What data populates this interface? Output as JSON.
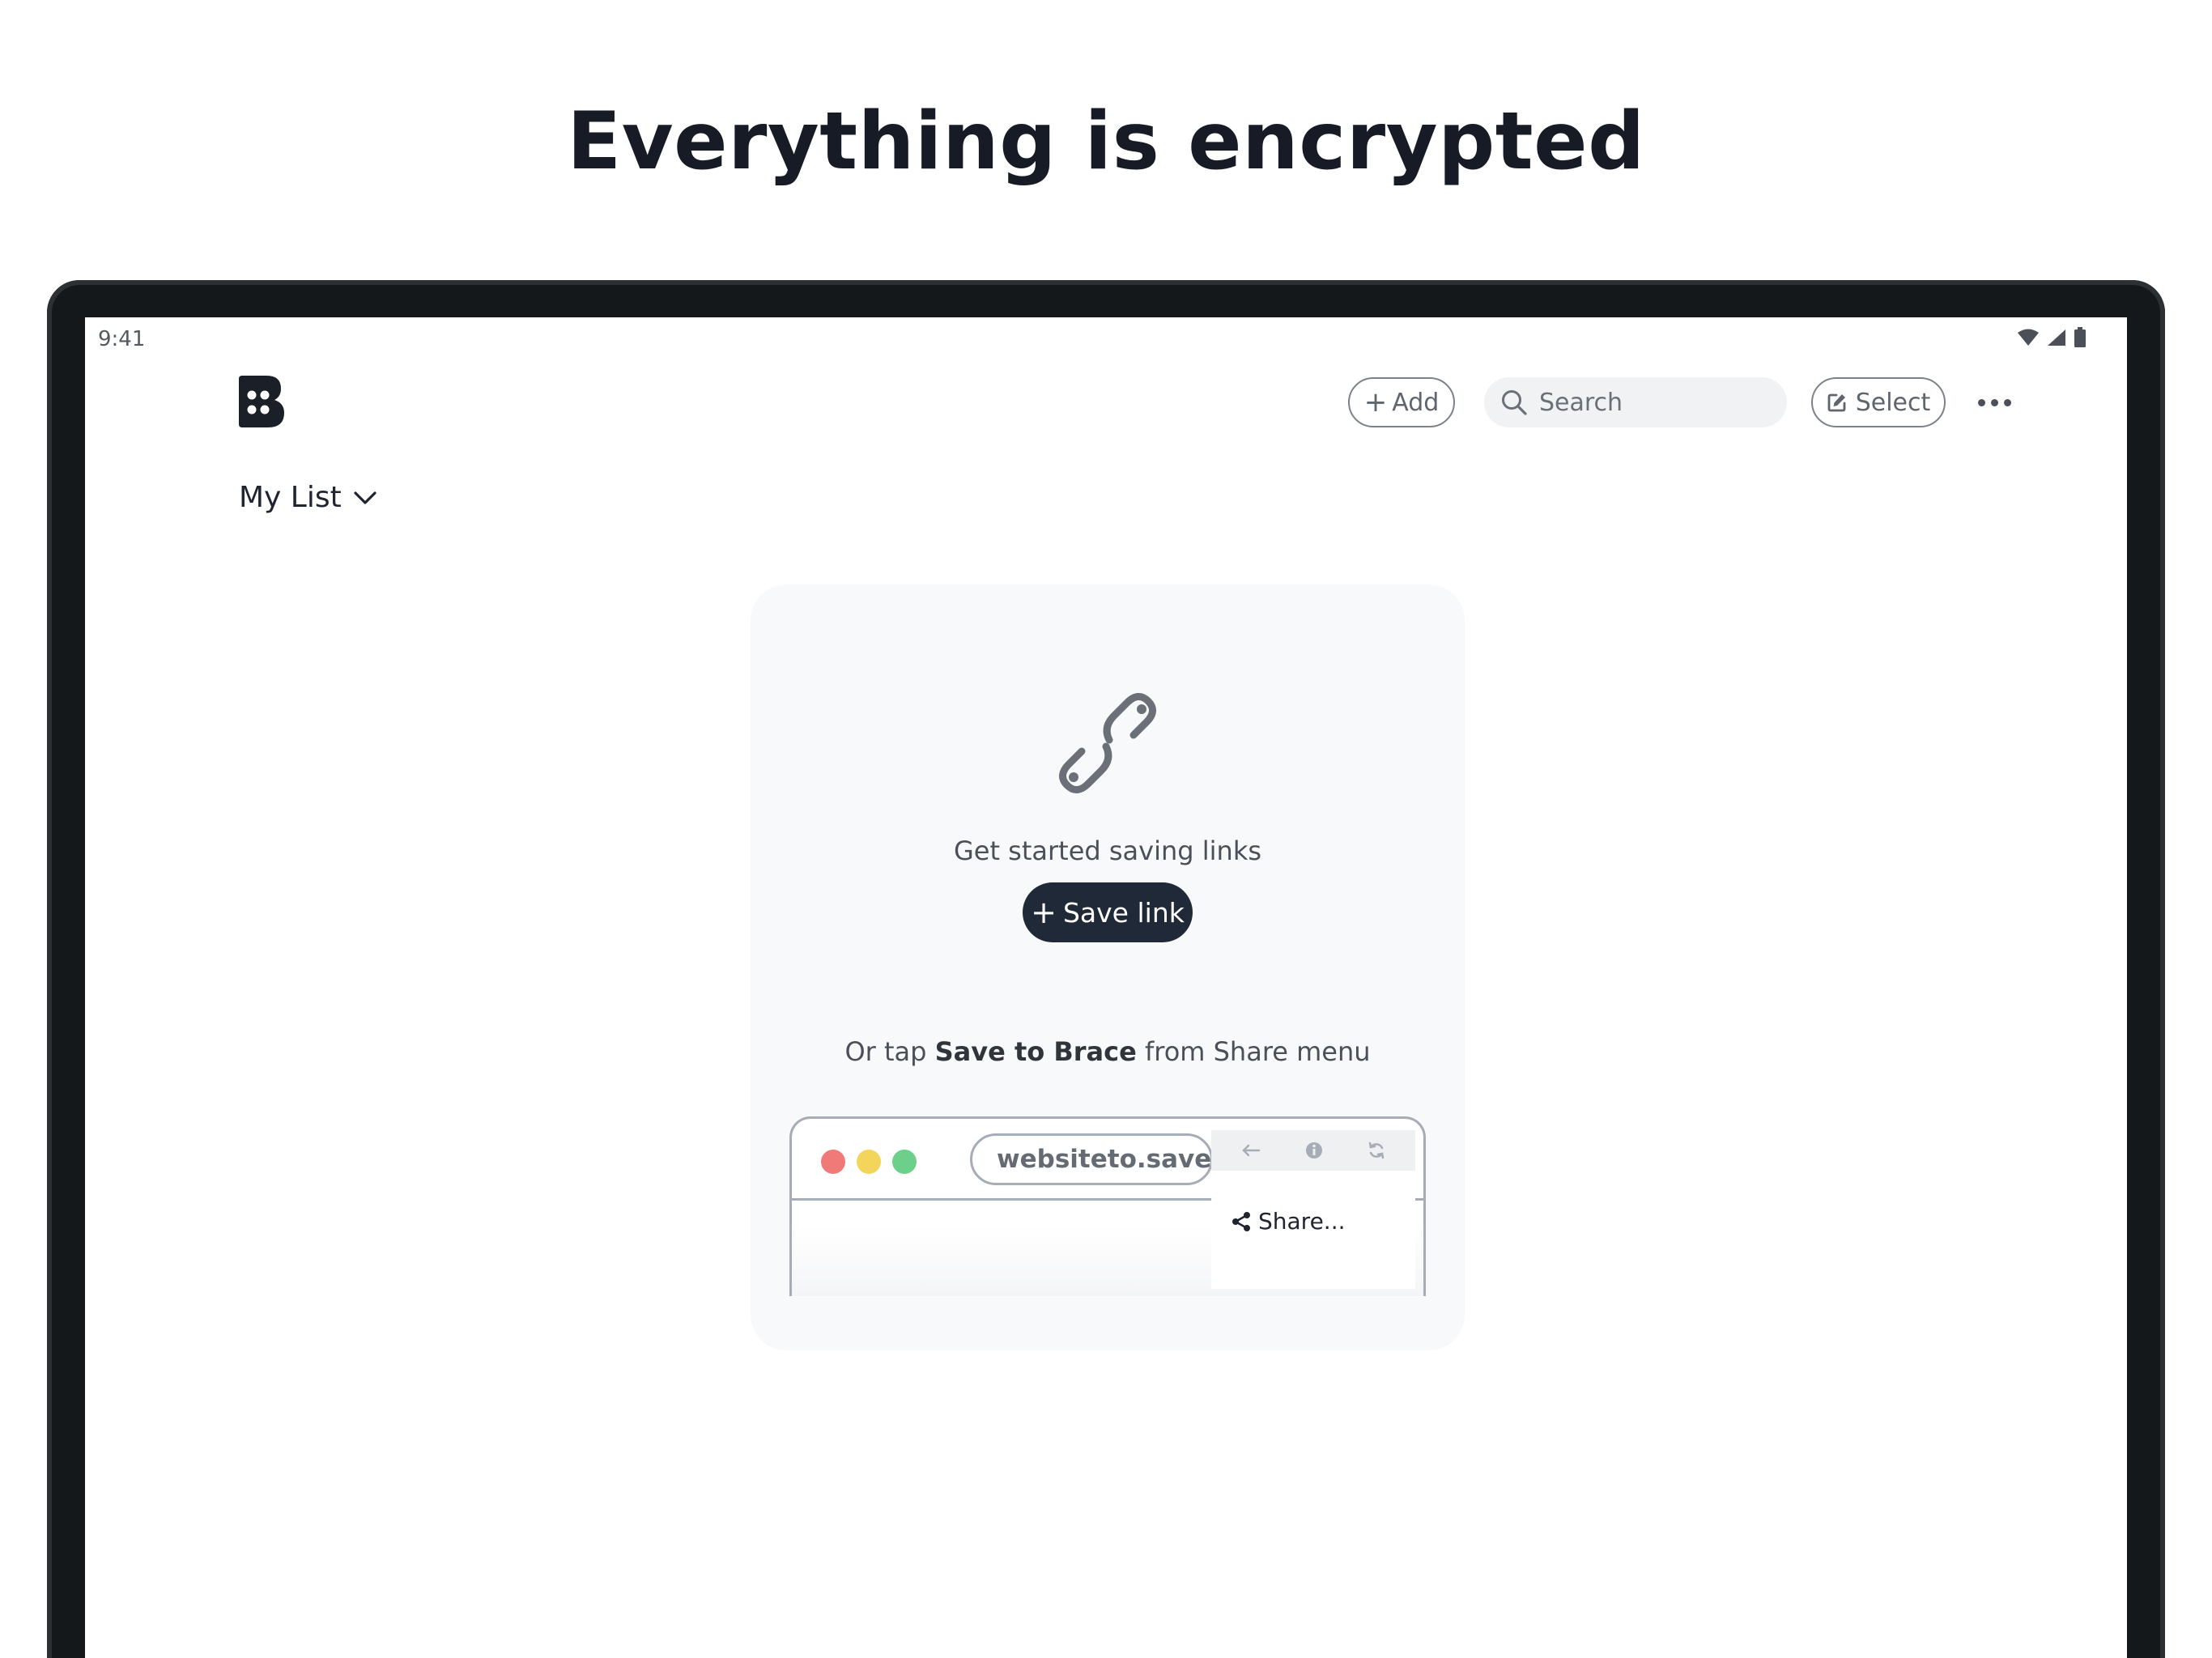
{
  "headline": "Everything is encrypted",
  "status_bar": {
    "time": "9:41",
    "icons": [
      "wifi-icon",
      "signal-icon",
      "battery-icon"
    ]
  },
  "toolbar": {
    "logo": "brace-logo",
    "add_label": "Add",
    "search_placeholder": "Search",
    "select_label": "Select",
    "more_icon": "more-horizontal-icon"
  },
  "list_selector": {
    "label": "My List",
    "icon": "chevron-down-icon"
  },
  "empty_state": {
    "icon": "link-icon",
    "message": "Get started saving links",
    "save_button_label": "Save link",
    "hint_prefix": "Or tap ",
    "hint_bold": "Save to Brace",
    "hint_suffix": " from Share menu",
    "illustration": {
      "url_text": "websiteto.save",
      "share_label": "Share...",
      "dot_colors": [
        "#f07a78",
        "#f3d55c",
        "#6ccf8a"
      ]
    }
  },
  "colors": {
    "primary_button": "#1f2937",
    "device_frame": "#14181b",
    "card_background": "#f8f9fa"
  }
}
